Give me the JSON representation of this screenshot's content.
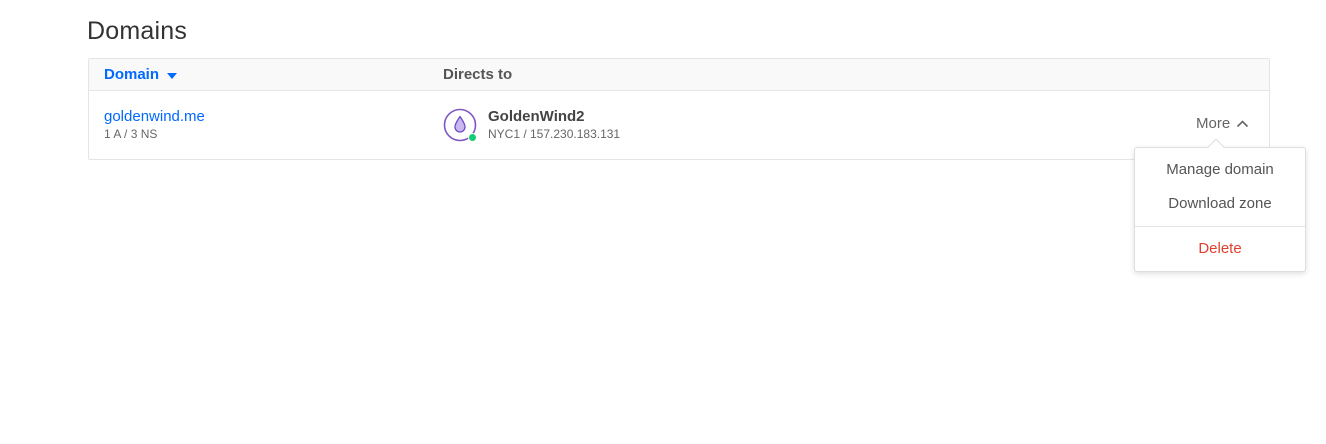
{
  "page": {
    "title": "Domains"
  },
  "table": {
    "headers": {
      "domain": "Domain",
      "directs_to": "Directs to"
    },
    "rows": [
      {
        "domain": "goldenwind.me",
        "records": "1 A / 3 NS",
        "droplet_name": "GoldenWind2",
        "droplet_meta": "NYC1 / 157.230.183.131",
        "more_label": "More"
      }
    ]
  },
  "dropdown": {
    "items": [
      "Manage domain",
      "Download zone"
    ],
    "danger_item": "Delete"
  },
  "colors": {
    "link": "#0069ff",
    "danger": "#e0402f",
    "status_active": "#15cd72",
    "droplet_icon": "#7e57c2"
  },
  "icons": {
    "sort": "caret-down-icon",
    "droplet": "droplet-icon",
    "more": "chevron-up-icon"
  }
}
